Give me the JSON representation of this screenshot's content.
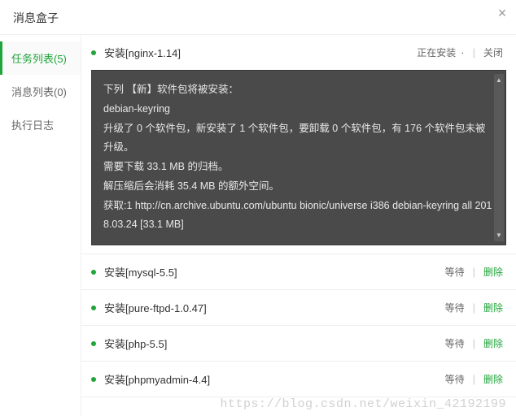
{
  "header": {
    "title": "消息盒子"
  },
  "sidebar": {
    "items": [
      {
        "label": "任务列表(5)"
      },
      {
        "label": "消息列表(0)"
      },
      {
        "label": "执行日志"
      }
    ]
  },
  "tasks": [
    {
      "title": "安装[nginx-1.14]",
      "status": "正在安装",
      "action1": "",
      "action2": "关闭",
      "console": {
        "line1": "下列 【新】软件包将被安装：",
        "line2": "debian-keyring",
        "line3": "升级了 0 个软件包，新安装了 1 个软件包，要卸载 0 个软件包，有 176 个软件包未被升级。",
        "line4": "需要下载 33.1 MB 的归档。",
        "line5": "解压缩后会消耗 35.4 MB 的额外空间。",
        "line6": "获取:1 http://cn.archive.ubuntu.com/ubuntu bionic/universe i386 debian-keyring all 2018.03.24 [33.1 MB]"
      }
    },
    {
      "title": "安装[mysql-5.5]",
      "status": "等待",
      "action2": "删除"
    },
    {
      "title": "安装[pure-ftpd-1.0.47]",
      "status": "等待",
      "action2": "删除"
    },
    {
      "title": "安装[php-5.5]",
      "status": "等待",
      "action2": "删除"
    },
    {
      "title": "安装[phpmyadmin-4.4]",
      "status": "等待",
      "action2": "删除"
    }
  ],
  "watermark": "https://blog.csdn.net/weixin_42192199"
}
